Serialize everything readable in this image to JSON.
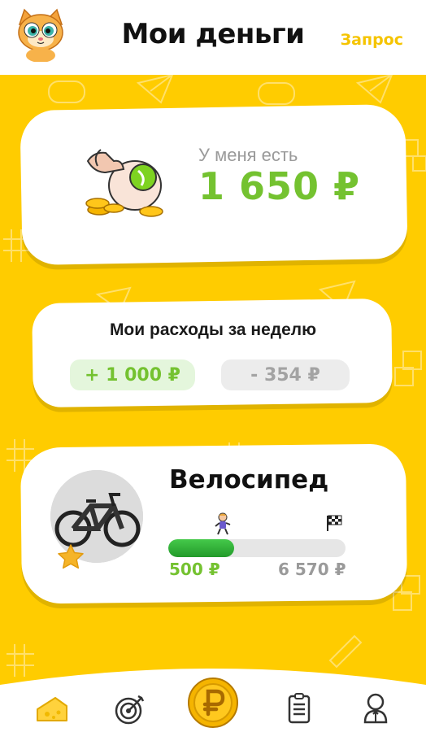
{
  "header": {
    "title": "Мои деньги",
    "request_label": "Запрос"
  },
  "balance": {
    "label": "У меня есть",
    "amount": "1 650 ₽"
  },
  "weekly_spending": {
    "title": "Мои расходы за неделю",
    "income": "+ 1 000 ₽",
    "expense": "- 354 ₽"
  },
  "goal": {
    "title": "Велосипед",
    "saved": "500 ₽",
    "target": "6 570 ₽",
    "progress_fraction": 0.37
  },
  "bottom_nav": {
    "items": [
      {
        "icon": "cheese-icon",
        "active": true
      },
      {
        "icon": "target-icon",
        "active": false
      },
      {
        "icon": "ruble-coin-icon",
        "active": false
      },
      {
        "icon": "task-list-icon",
        "active": false
      },
      {
        "icon": "profile-icon",
        "active": false
      }
    ]
  },
  "colors": {
    "background": "#ffcc00",
    "accent_green": "#74c230",
    "accent_yellow": "#f5c400",
    "muted_gray": "#9a9a9a"
  }
}
